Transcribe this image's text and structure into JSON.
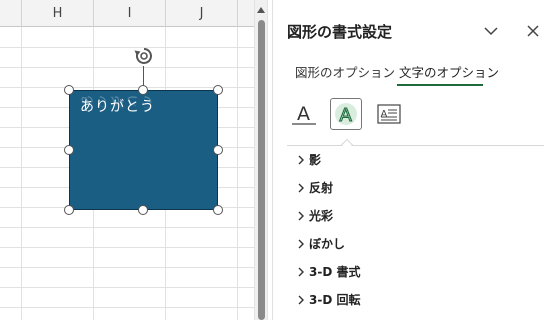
{
  "sheet": {
    "columns": [
      "H",
      "I",
      "J"
    ]
  },
  "shape": {
    "text": "ありがとう",
    "fill_color": "#1b5e84"
  },
  "pane": {
    "title": "図形の書式設定",
    "tabs": [
      {
        "label": "図形のオプション",
        "active": false
      },
      {
        "label": "文字のオプション",
        "active": true
      }
    ],
    "icon_buttons": [
      {
        "name": "text-fill-outline-icon",
        "selected": false
      },
      {
        "name": "text-effects-icon",
        "selected": true
      },
      {
        "name": "textbox-icon",
        "selected": false
      }
    ],
    "sections": [
      {
        "label": "影"
      },
      {
        "label": "反射"
      },
      {
        "label": "光彩"
      },
      {
        "label": "ぼかし"
      },
      {
        "label": "3-D 書式"
      },
      {
        "label": "3-D 回転"
      }
    ],
    "accent_color": "#1e6b3c"
  }
}
